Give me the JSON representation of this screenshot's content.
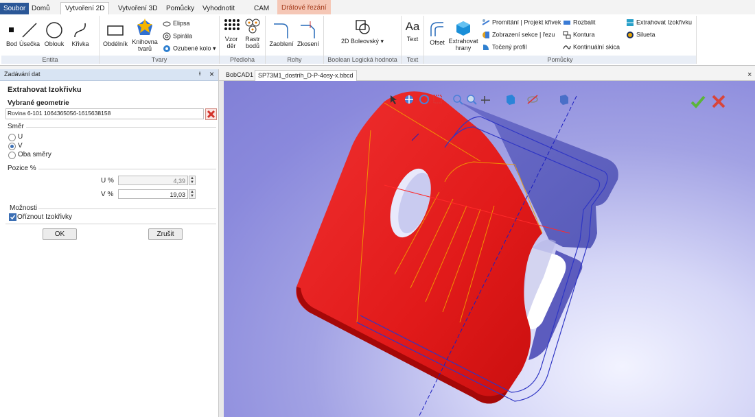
{
  "ribbon": {
    "tabs": [
      "Soubor",
      "Domů",
      "Vytvoření 2D",
      "Vytvoření 3D",
      "Pomůcky",
      "Vyhodnotit",
      "CAM",
      "Drátové řezání"
    ],
    "groups": {
      "entita": {
        "label": "Entita",
        "buttons": [
          "Bod",
          "Úsečka",
          "Oblouk",
          "Křivka"
        ]
      },
      "tvary": {
        "label": "Tvary",
        "buttons": [
          "Obdélník",
          "Knihovna tvarů"
        ],
        "small": [
          "Elipsa",
          "Spirála",
          "Ozubené kolo"
        ]
      },
      "predloha": {
        "label": "Předloha",
        "buttons": [
          "Vzor děr",
          "Rastr bodů"
        ]
      },
      "rohy": {
        "label": "Rohy",
        "buttons": [
          "Zaoblení",
          "Zkosení"
        ]
      },
      "boolean": {
        "label": "Boolean Logická hodnota",
        "buttons": [
          "2D Boleovský"
        ]
      },
      "text": {
        "label": "Text",
        "buttons": [
          "Text"
        ],
        "icon_text": "Aa"
      },
      "pomucky": {
        "label": "Pomůcky",
        "buttons": [
          "Ofset",
          "Extrahovat hrany"
        ],
        "small": [
          "Promítání | Projekt křivek",
          "Zobrazení sekce | řezu",
          "Točený profil",
          "Rozbalit",
          "Kontura",
          "Kontinuální skica",
          "Extrahovat Izokřivku",
          "Silueta"
        ]
      }
    }
  },
  "panel": {
    "header": "Zadávání dat",
    "pin": "ᵼ",
    "close": "×",
    "title": "Extrahovat Izokřivku",
    "geom_title": "Vybrané geometrie",
    "geom_value": "Rovina  6-101 1064365056-1615638158",
    "smer": {
      "label": "Směr",
      "options": [
        "U",
        "V",
        "Oba směry"
      ],
      "selected": "V"
    },
    "pozice": {
      "label": "Pozice %",
      "u_label": "U %",
      "u_value": "4,39",
      "v_label": "V %",
      "v_value": "19,03"
    },
    "moznosti": {
      "label": "Možnosti",
      "checkbox": "Oříznout Izokřivky",
      "checked": true
    },
    "ok": "OK",
    "cancel": "Zrušit"
  },
  "documents": {
    "tabs": [
      "BobCAD1",
      "SP73M1_dostrih_D-P-4osy-x.bbcd"
    ],
    "close": "×"
  },
  "colors": {
    "accent": "#2b5797",
    "model_red": "#e31b1b",
    "model_blue": "#6d6ec7",
    "confirm": "#5bb53b",
    "cancel": "#d9453a"
  }
}
